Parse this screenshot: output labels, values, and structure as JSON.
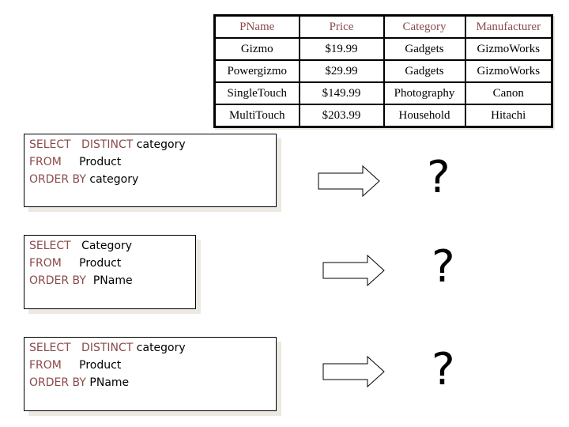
{
  "colors": {
    "keyword": "#8b4a4a",
    "header": "#8b4a4a",
    "text": "#000000"
  },
  "table": {
    "headers": [
      "PName",
      "Price",
      "Category",
      "Manufacturer"
    ],
    "rows": [
      [
        "Gizmo",
        "$19.99",
        "Gadgets",
        "GizmoWorks"
      ],
      [
        "Powergizmo",
        "$29.99",
        "Gadgets",
        "GizmoWorks"
      ],
      [
        "SingleTouch",
        "$149.99",
        "Photography",
        "Canon"
      ],
      [
        "MultiTouch",
        "$203.99",
        "Household",
        "Hitachi"
      ]
    ]
  },
  "queries": [
    {
      "lines": [
        {
          "keyword": "SELECT   DISTINCT",
          "rest": " category"
        },
        {
          "keyword": "FROM",
          "rest": "     Product"
        },
        {
          "keyword": "ORDER BY",
          "rest": " category"
        }
      ],
      "result": "?"
    },
    {
      "lines": [
        {
          "keyword": "SELECT",
          "rest": "   Category"
        },
        {
          "keyword": "FROM",
          "rest": "     Product"
        },
        {
          "keyword": "ORDER BY",
          "rest": "  PName"
        }
      ],
      "result": "?"
    },
    {
      "lines": [
        {
          "keyword": "SELECT   DISTINCT",
          "rest": " category"
        },
        {
          "keyword": "FROM",
          "rest": "     Product"
        },
        {
          "keyword": "ORDER BY",
          "rest": " PName"
        }
      ],
      "result": "?"
    }
  ],
  "icons": {
    "arrow": "right-arrow-icon",
    "result": "question-mark"
  }
}
